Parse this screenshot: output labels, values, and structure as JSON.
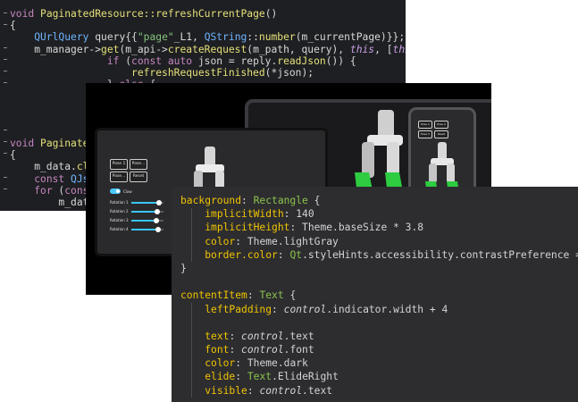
{
  "code_back": {
    "lines": [
      "void PaginatedResource::refreshCurrentPage()",
      "{",
      "    QUrlQuery query{{\"page\"_L1, QString::number(m_currentPage)}};",
      "    m_manager->get(m_api->createRequest(m_path, query), this, [this](QRest",
      "                if (const auto json = reply.readJson()) {",
      "                    refreshRequestFinished(*json);",
      "                } else {",
      "",
      "",
      "",
      "",
      "void Paginated",
      "{",
      "    m_data.cle",
      "    const QJso",
      "    for (const",
      "        m_data"
    ]
  },
  "device_ui": {
    "buttons_a": [
      "Pose 1",
      "Pose...",
      "Pose...",
      "Reset"
    ],
    "buttons_b": [
      "Pose 1",
      "Pose...",
      "Pose...",
      "Reset"
    ],
    "buttons_phone": [
      "Pose 1",
      "Pose 2",
      "Pose 3",
      "Reset"
    ],
    "claw_label": "Claw",
    "rotations": [
      "Rotation 1",
      "Rotation 2",
      "Rotation 3",
      "Rotation 4"
    ],
    "slider_levels": [
      0.82,
      0.78,
      0.74,
      0.8
    ],
    "accent": "#39c5ff",
    "robot_green": "#2ecc40"
  },
  "code_front": {
    "lines": [
      {
        "parts": [
          [
            "pr",
            "background"
          ],
          [
            "nm",
            ": "
          ],
          [
            "qt",
            "Rectangle"
          ],
          [
            "nm",
            " {"
          ]
        ]
      },
      {
        "parts": [
          [
            "nm",
            "    "
          ],
          [
            "pr",
            "implicitWidth"
          ],
          [
            "nm",
            ": 140"
          ]
        ]
      },
      {
        "parts": [
          [
            "nm",
            "    "
          ],
          [
            "pr",
            "implicitHeight"
          ],
          [
            "nm",
            ": Theme.baseSize * 3.8"
          ]
        ]
      },
      {
        "parts": [
          [
            "nm",
            "    "
          ],
          [
            "pr",
            "color"
          ],
          [
            "nm",
            ": Theme.lightGray"
          ]
        ]
      },
      {
        "parts": [
          [
            "nm",
            "    "
          ],
          [
            "pr",
            "border.color"
          ],
          [
            "nm",
            ": "
          ],
          [
            "qt",
            "Qt"
          ],
          [
            "nm",
            ".styleHints.accessibility.contrastPreference ==="
          ]
        ]
      },
      {
        "parts": [
          [
            "nm",
            "}"
          ]
        ]
      },
      {
        "parts": []
      },
      {
        "parts": [
          [
            "pr",
            "contentItem"
          ],
          [
            "nm",
            ": "
          ],
          [
            "qt",
            "Text"
          ],
          [
            "nm",
            " {"
          ]
        ]
      },
      {
        "parts": [
          [
            "nm",
            "    "
          ],
          [
            "pr",
            "leftPadding"
          ],
          [
            "nm",
            ": "
          ],
          [
            "it",
            "control"
          ],
          [
            "nm",
            ".indicator.width + 4"
          ]
        ]
      },
      {
        "parts": []
      },
      {
        "parts": [
          [
            "nm",
            "    "
          ],
          [
            "pr",
            "text"
          ],
          [
            "nm",
            ": "
          ],
          [
            "it",
            "control"
          ],
          [
            "nm",
            ".text"
          ]
        ]
      },
      {
        "parts": [
          [
            "nm",
            "    "
          ],
          [
            "pr",
            "font"
          ],
          [
            "nm",
            ": "
          ],
          [
            "it",
            "control"
          ],
          [
            "nm",
            ".font"
          ]
        ]
      },
      {
        "parts": [
          [
            "nm",
            "    "
          ],
          [
            "pr",
            "color"
          ],
          [
            "nm",
            ": Theme.dark"
          ]
        ]
      },
      {
        "parts": [
          [
            "nm",
            "    "
          ],
          [
            "pr",
            "elide"
          ],
          [
            "nm",
            ": "
          ],
          [
            "qt",
            "Text"
          ],
          [
            "nm",
            ".ElideRight"
          ]
        ]
      },
      {
        "parts": [
          [
            "nm",
            "    "
          ],
          [
            "pr",
            "visible"
          ],
          [
            "nm",
            ": "
          ],
          [
            "it",
            "control"
          ],
          [
            "nm",
            ".text"
          ]
        ]
      }
    ]
  }
}
